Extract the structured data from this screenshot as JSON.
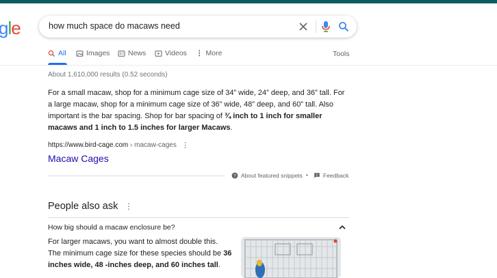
{
  "logo": {
    "letters": [
      "g",
      "l",
      "e"
    ],
    "colors": [
      "#4285f4",
      "#34a853",
      "#ea4335"
    ]
  },
  "search": {
    "query": "how much space do macaws need"
  },
  "tabs": [
    {
      "label": "All"
    },
    {
      "label": "Images"
    },
    {
      "label": "News"
    },
    {
      "label": "Videos"
    },
    {
      "label": "More"
    }
  ],
  "tools_label": "Tools",
  "stats": "About 1,610,000 results (0.52 seconds)",
  "snippet": {
    "text1": "For a small macaw, shop for a minimum cage size of 34” wide, 24” deep, and 36” tall. For a large macaw, shop for a minimum cage size of 36” wide, 48” deep, and 60” tall. Also important is the bar spacing. Shop for bar spacing of ",
    "bold": "¾ inch to 1 inch for smaller macaws and 1 inch to 1.5 inches for larger Macaws",
    "text2": "."
  },
  "source": {
    "domain": "https://www.bird-cage.com",
    "path": " › macaw-cages"
  },
  "result_title": "Macaw Cages",
  "about_label": "About featured snippets",
  "feedback_label": "Feedback",
  "paa": {
    "title": "People also ask",
    "question": "How big should a macaw enclosure be?",
    "answer_text": "For larger macaws, you want to almost double this. The minimum cage size for these species should be ",
    "answer_bold": "36 inches wide, 48 -inches deep, and 60 inches tall",
    "answer_end": "."
  },
  "colors": {
    "accent": "#1a73e8",
    "link": "#1a0dab",
    "topbar": "#0d5c63"
  }
}
